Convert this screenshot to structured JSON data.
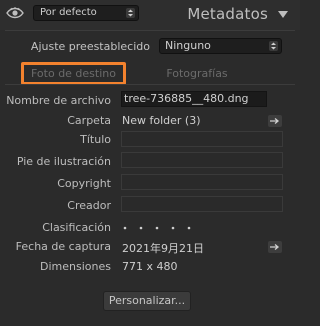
{
  "header": {
    "preset_value": "Por defecto",
    "title": "Metadatos"
  },
  "ajuste": {
    "label": "Ajuste preestablecido",
    "value": "Ninguno"
  },
  "tabs": [
    {
      "label": "Foto de destino"
    },
    {
      "label": "Fotografías seleccionadas"
    }
  ],
  "fields": {
    "nombre": {
      "label": "Nombre de archivo",
      "value": "tree-736885__480.dng"
    },
    "carpeta": {
      "label": "Carpeta",
      "value": "New folder (3)"
    },
    "titulo": {
      "label": "Título",
      "value": ""
    },
    "pie": {
      "label": "Pie de ilustración",
      "value": ""
    },
    "copyright": {
      "label": "Copyright",
      "value": ""
    },
    "creador": {
      "label": "Creador",
      "value": ""
    },
    "clasificacion": {
      "label": "Clasificación"
    },
    "fecha": {
      "label": "Fecha de captura",
      "value": "2021年9月21日"
    },
    "dimensiones": {
      "label": "Dimensiones",
      "value": "771 x 480"
    }
  },
  "buttons": {
    "personalizar": "Personalizar..."
  },
  "colors": {
    "highlight": "#f3822e",
    "panel_bg": "#2b2b2b"
  }
}
